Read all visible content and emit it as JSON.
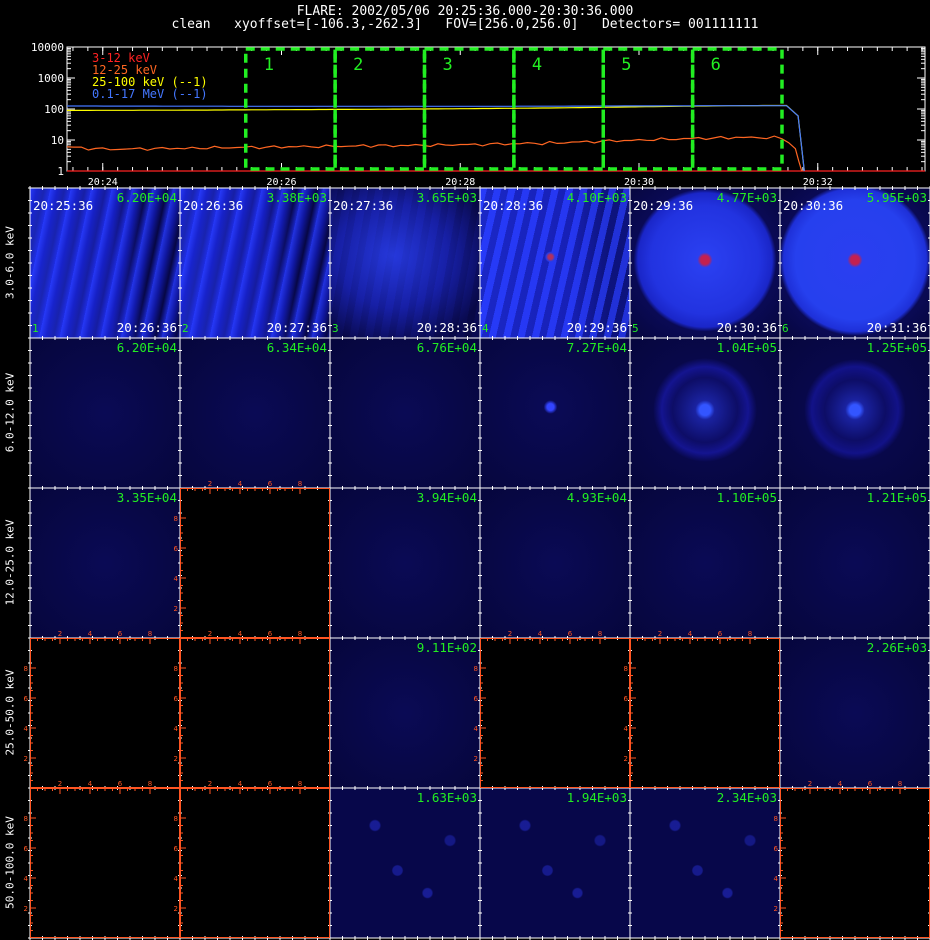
{
  "header": {
    "line1": "FLARE: 2002/05/06 20:25:36.000-20:30:36.000",
    "line2": "clean   xyoffset=[-106.3,-262.3]   FOV=[256.0,256.0]   Detectors= 001111111"
  },
  "chart_data": [
    {
      "type": "line",
      "yscale": "log",
      "ylim": [
        1,
        10000
      ],
      "y_tick_labels": [
        "1",
        "10",
        "100",
        "1000",
        "10000"
      ],
      "x_tick_labels": [
        "20:24",
        "20:26",
        "20:28",
        "20:30",
        "20:32"
      ],
      "xlim_minutes": [
        23.6,
        33.2
      ],
      "x_tick_minutes": [
        24,
        26,
        28,
        30,
        32
      ],
      "series": [
        {
          "name": "3-12 keV",
          "color": "#ff2222",
          "points": [
            [
              23.6,
              1
            ],
            [
              33.2,
              1
            ]
          ]
        },
        {
          "name": "12-25 keV",
          "color": "#ff6622",
          "points": [
            [
              23.6,
              6
            ],
            [
              24,
              5
            ],
            [
              25,
              5.5
            ],
            [
              26,
              6
            ],
            [
              27,
              6.5
            ],
            [
              28,
              7
            ],
            [
              29,
              8
            ],
            [
              30,
              10
            ],
            [
              31,
              12
            ],
            [
              31.6,
              12
            ],
            [
              31.75,
              5
            ],
            [
              31.82,
              1
            ]
          ]
        },
        {
          "name": "25-100 keV (--1)",
          "color": "#ffff00",
          "points": [
            [
              23.6,
              90
            ],
            [
              25,
              92
            ],
            [
              26,
              95
            ],
            [
              27,
              98
            ],
            [
              28,
              102
            ],
            [
              29,
              108
            ],
            [
              30,
              118
            ],
            [
              31,
              128
            ],
            [
              31.65,
              130
            ],
            [
              31.78,
              60
            ],
            [
              31.85,
              1
            ]
          ]
        },
        {
          "name": "0.1-17 MeV (--1)",
          "color": "#4477ff",
          "points": [
            [
              23.6,
              125
            ],
            [
              25,
              123
            ],
            [
              26,
              122
            ],
            [
              27,
              122
            ],
            [
              28,
              122
            ],
            [
              29,
              123
            ],
            [
              30,
              126
            ],
            [
              31,
              128
            ],
            [
              31.65,
              128
            ],
            [
              31.78,
              60
            ],
            [
              31.85,
              1
            ]
          ]
        }
      ],
      "intervals": {
        "color": "#22ee22",
        "labels": [
          "1",
          "2",
          "3",
          "4",
          "5",
          "6"
        ],
        "bounds_minutes": [
          25.6,
          26.6,
          27.6,
          28.6,
          29.6,
          30.6,
          31.6
        ]
      }
    },
    {
      "type": "heatmap",
      "rows": [
        "3.0-6.0 keV",
        "6.0-12.0 keV",
        "12.0-25.0 keV",
        "25.0-50.0 keV",
        "50.0-100.0 keV"
      ],
      "columns": [
        "1",
        "2",
        "3",
        "4",
        "5",
        "6"
      ],
      "start_times": [
        "20:25:36",
        "20:26:36",
        "20:27:36",
        "20:28:36",
        "20:29:36",
        "20:30:36"
      ],
      "end_times": [
        "20:26:36",
        "20:27:36",
        "20:28:36",
        "20:29:36",
        "20:30:36",
        "20:31:36"
      ],
      "max_values": [
        [
          "6.20E+04",
          "3.38E+03",
          "3.65E+03",
          "4.10E+03",
          "4.77E+03",
          "5.95E+03"
        ],
        [
          "6.20E+04",
          "6.34E+04",
          "6.76E+04",
          "7.27E+04",
          "1.04E+05",
          "1.25E+05"
        ],
        [
          "3.35E+04",
          "",
          "3.94E+04",
          "4.93E+04",
          "1.10E+05",
          "1.21E+05"
        ],
        [
          "",
          "",
          "9.11E+02",
          "",
          "",
          "2.26E+03"
        ],
        [
          "",
          "",
          "1.63E+03",
          "1.94E+03",
          "2.34E+03",
          ""
        ]
      ],
      "empty_axis_tick_labels": [
        "2",
        "4",
        "6",
        "8"
      ]
    }
  ]
}
